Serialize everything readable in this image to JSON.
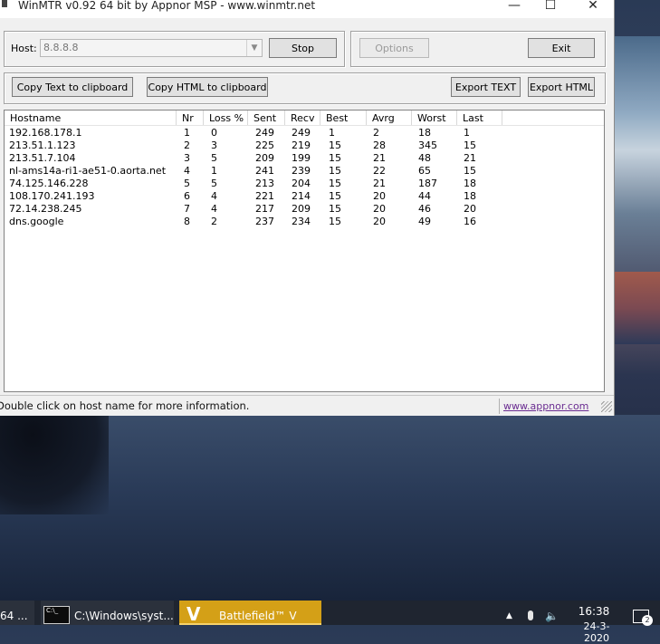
{
  "window": {
    "title": "WinMTR v0.92 64 bit by Appnor MSP - www.winmtr.net",
    "controls": {
      "minimize": "—",
      "maximize": "☐",
      "close": "✕"
    }
  },
  "host": {
    "label": "Host:",
    "value": "8.8.8.8"
  },
  "buttons": {
    "stop": "Stop",
    "options": "Options",
    "exit": "Exit",
    "copy_text": "Copy Text to clipboard",
    "copy_html": "Copy HTML to clipboard",
    "export_text": "Export TEXT",
    "export_html": "Export HTML"
  },
  "table": {
    "columns": [
      "Hostname",
      "Nr",
      "Loss %",
      "Sent",
      "Recv",
      "Best",
      "Avrg",
      "Worst",
      "Last"
    ],
    "rows": [
      [
        "192.168.178.1",
        "1",
        "0",
        "249",
        "249",
        "1",
        "2",
        "18",
        "1"
      ],
      [
        "213.51.1.123",
        "2",
        "3",
        "225",
        "219",
        "15",
        "28",
        "345",
        "15"
      ],
      [
        "213.51.7.104",
        "3",
        "5",
        "209",
        "199",
        "15",
        "21",
        "48",
        "21"
      ],
      [
        "nl-ams14a-ri1-ae51-0.aorta.net",
        "4",
        "1",
        "241",
        "239",
        "15",
        "22",
        "65",
        "15"
      ],
      [
        "74.125.146.228",
        "5",
        "5",
        "213",
        "204",
        "15",
        "21",
        "187",
        "18"
      ],
      [
        "108.170.241.193",
        "6",
        "4",
        "221",
        "214",
        "15",
        "20",
        "44",
        "18"
      ],
      [
        "72.14.238.245",
        "7",
        "4",
        "217",
        "209",
        "15",
        "20",
        "46",
        "20"
      ],
      [
        "dns.google",
        "8",
        "2",
        "237",
        "234",
        "15",
        "20",
        "49",
        "16"
      ]
    ]
  },
  "status": {
    "text": "Double click on host name for more information.",
    "link": "www.appnor.com"
  },
  "taskbar": {
    "items": [
      {
        "label": "64 ..."
      },
      {
        "label": "C:\\Windows\\syst...",
        "icon_text": "C:\\_"
      },
      {
        "label": "Battlefield™ V",
        "icon_text": "V"
      }
    ],
    "tray": {
      "up_arrow": "▲",
      "volume": "🔈"
    },
    "clock": {
      "time": "16:38",
      "date": "24-3-2020"
    },
    "notifications": "2"
  },
  "colors": {
    "link": "#6a2c91",
    "battlefield": "#d4a017"
  }
}
